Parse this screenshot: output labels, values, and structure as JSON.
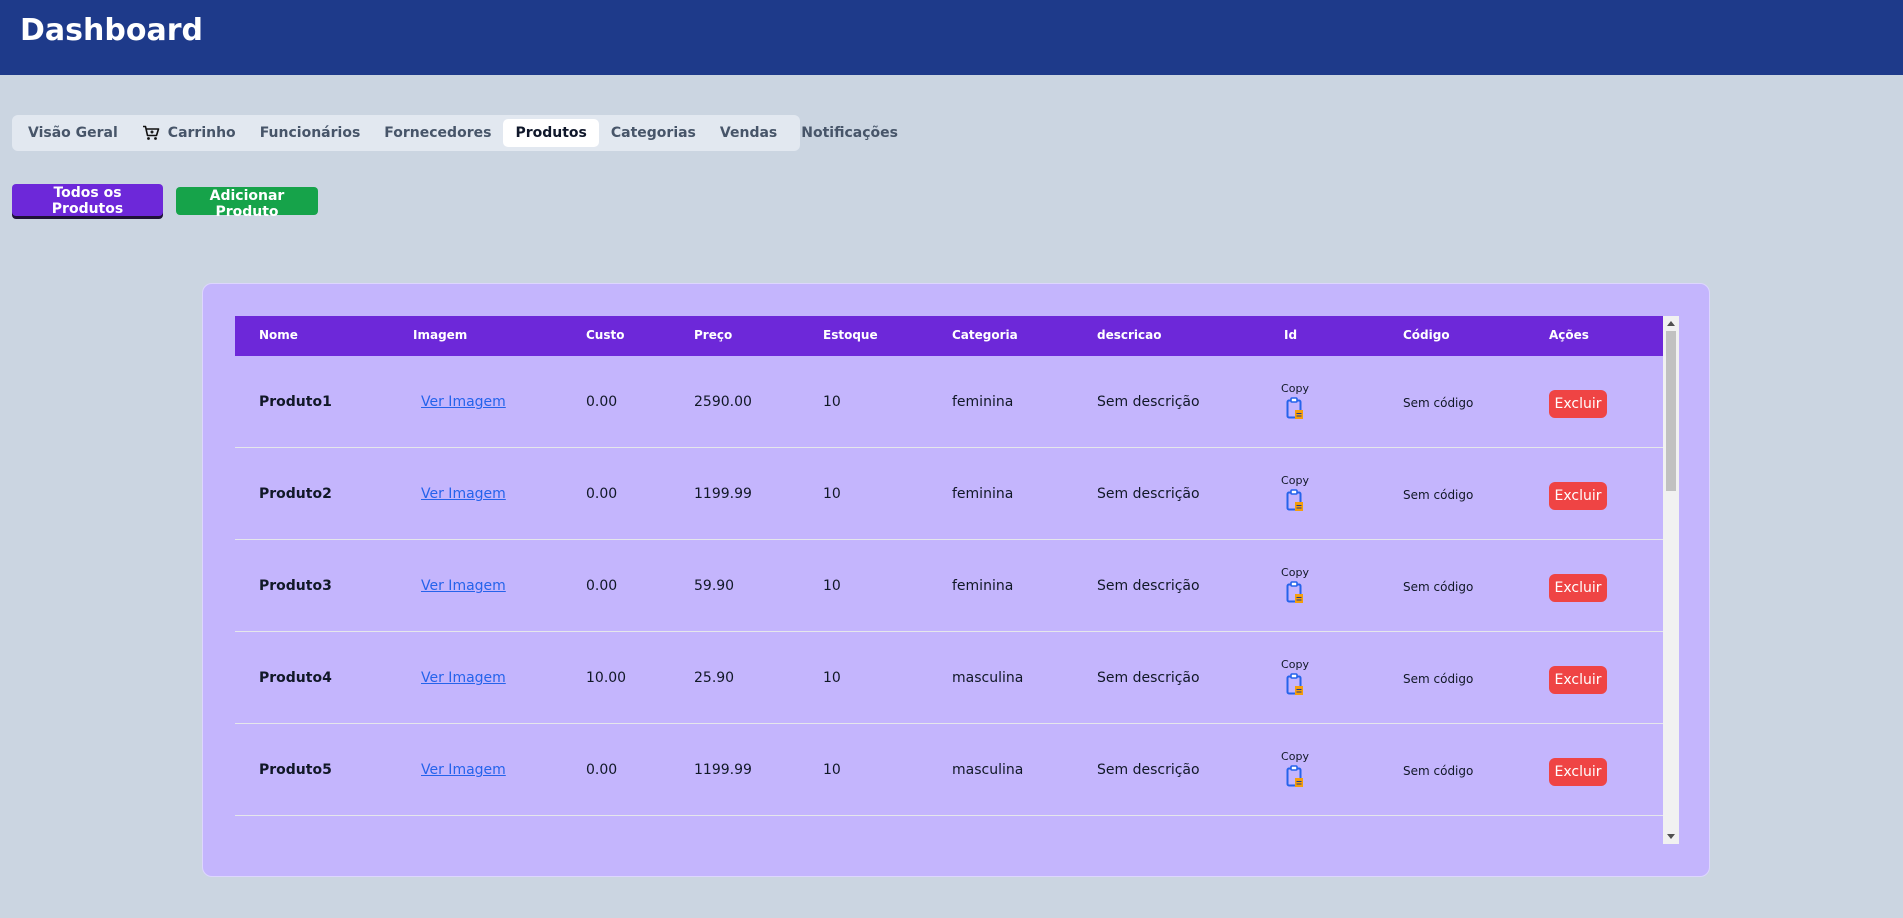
{
  "header": {
    "title": "Dashboard"
  },
  "tabs": [
    {
      "label": "Visão Geral",
      "icon": ""
    },
    {
      "label": "Carrinho",
      "icon": "cart-icon"
    },
    {
      "label": "Funcionários",
      "icon": ""
    },
    {
      "label": "Fornecedores",
      "icon": ""
    },
    {
      "label": "Produtos",
      "icon": "",
      "active": true
    },
    {
      "label": "Categorias",
      "icon": ""
    },
    {
      "label": "Vendas",
      "icon": ""
    },
    {
      "label": "Notificações",
      "icon": ""
    }
  ],
  "actions": {
    "all_label": "Todos os Produtos",
    "add_label": "Adicionar Produto"
  },
  "table": {
    "columns": [
      "Nome",
      "Imagem",
      "Custo",
      "Preço",
      "Estoque",
      "Categoria",
      "descricao",
      "Id",
      "Código",
      "Ações"
    ],
    "image_link_label": "Ver Imagem",
    "copy_label": "Copy",
    "delete_label": "Excluir",
    "rows": [
      {
        "nome": "Produto1",
        "custo": "0.00",
        "preco": "2590.00",
        "estoque": "10",
        "categoria": "feminina",
        "descricao": "Sem descrição",
        "codigo": "Sem código"
      },
      {
        "nome": "Produto2",
        "custo": "0.00",
        "preco": "1199.99",
        "estoque": "10",
        "categoria": "feminina",
        "descricao": "Sem descrição",
        "codigo": "Sem código"
      },
      {
        "nome": "Produto3",
        "custo": "0.00",
        "preco": "59.90",
        "estoque": "10",
        "categoria": "feminina",
        "descricao": "Sem descrição",
        "codigo": "Sem código"
      },
      {
        "nome": "Produto4",
        "custo": "10.00",
        "preco": "25.90",
        "estoque": "10",
        "categoria": "masculina",
        "descricao": "Sem descrição",
        "codigo": "Sem código"
      },
      {
        "nome": "Produto5",
        "custo": "0.00",
        "preco": "1199.99",
        "estoque": "10",
        "categoria": "masculina",
        "descricao": "Sem descrição",
        "codigo": "Sem código"
      }
    ]
  },
  "colors": {
    "header_bg": "#1e3a8a",
    "page_bg": "#cbd5e1",
    "panel_bg": "#c4b5fd",
    "table_head_bg": "#6d28d9",
    "primary_button": "#6d28d9",
    "add_button": "#16a34a",
    "delete_button": "#ef4444",
    "link": "#2563eb"
  }
}
